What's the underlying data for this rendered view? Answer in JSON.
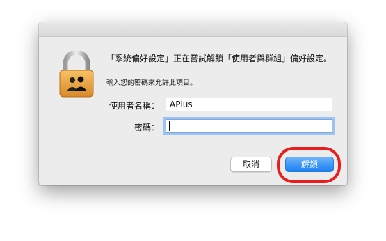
{
  "dialog": {
    "message": "「系統偏好設定」正在嘗試解鎖「使用者與群組」偏好設定。",
    "submessage": "輸入您的密碼來允許此項目。",
    "username_label": "使用者名稱：",
    "username_value": "APlus",
    "password_label": "密碼：",
    "password_value": "",
    "cancel_label": "取消",
    "unlock_label": "解鎖"
  },
  "icons": {
    "main": "lock-users-icon"
  },
  "colors": {
    "accent": "#1a7ff3",
    "annotation": "#e81d1d",
    "lock_gold": "#e8a33d"
  }
}
